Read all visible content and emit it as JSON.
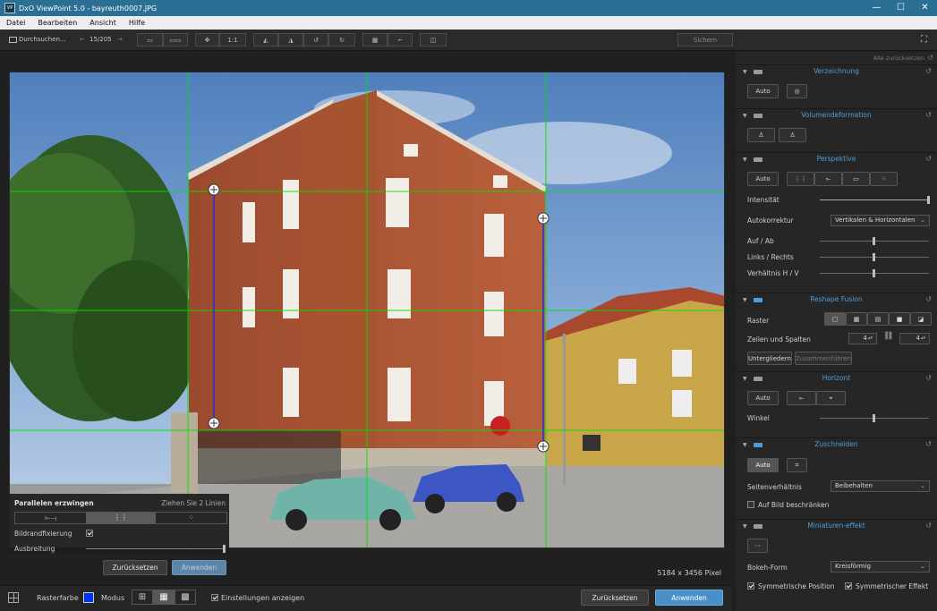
{
  "window": {
    "title": "DxO ViewPoint 5.0 - bayreuth0007.JPG",
    "app_icon": "VP",
    "min": "—",
    "max": "☐",
    "close": "✕"
  },
  "menu": [
    "Datei",
    "Bearbeiten",
    "Ansicht",
    "Hilfe"
  ],
  "toolbar": {
    "browse": "Durchsuchen...",
    "counter": "15/205",
    "prev": "←",
    "next": "→",
    "one_to_one": "1:1",
    "save": "Sichern"
  },
  "image": {
    "dimensions": "5184 x 3456 Pixel"
  },
  "parallel_panel": {
    "title": "Parallelen erzwingen",
    "hint": "Ziehen Sie 2 Linien",
    "edge_fix_label": "Bildrandfixierung",
    "edge_fix_checked": true,
    "spread_label": "Ausbreitung",
    "spread_value": 1.0,
    "reset": "Zurücksetzen",
    "apply": "Anwenden"
  },
  "bottom": {
    "grid_color_label": "Rasterfarbe",
    "grid_color": "#0033ff",
    "mode_label": "Modus",
    "show_settings_label": "Einstellungen anzeigen",
    "show_settings_checked": true,
    "reset": "Zurücksetzen",
    "apply": "Anwenden"
  },
  "right_panel": {
    "reset_all": "Alle zurücksetzen",
    "distortion": {
      "title": "Verzeichnung",
      "auto": "Auto"
    },
    "volume": {
      "title": "Volumendeformation"
    },
    "perspective": {
      "title": "Perspektive",
      "auto": "Auto",
      "intensity_label": "Intensität",
      "intensity_value": 1.0,
      "autocorrect_label": "Autokorrektur",
      "autocorrect_value": "Vertikalen & Horizontalen",
      "updown_label": "Auf / Ab",
      "updown_value": 0.5,
      "leftright_label": "Links / Rechts",
      "leftright_value": 0.5,
      "ratio_label": "Verhältnis H / V",
      "ratio_value": 0.5
    },
    "reshape": {
      "title": "Reshape Fusion",
      "grid_label": "Raster",
      "rows_cols_label": "Zeilen und Spalten",
      "rows": "4",
      "cols": "4",
      "subdivide": "Untergliedern",
      "merge": "Zusammenführen"
    },
    "horizon": {
      "title": "Horizont",
      "auto": "Auto",
      "angle_label": "Winkel",
      "angle_value": 0.5
    },
    "crop": {
      "title": "Zuschneiden",
      "auto": "Auto",
      "aspect_label": "Seitenverhältnis",
      "aspect_value": "Beibehalten",
      "limit_label": "Auf Bild beschränken",
      "limit_checked": false
    },
    "miniature": {
      "title": "Miniaturen-effekt",
      "bokeh_label": "Bokeh-Form",
      "bokeh_value": "Kreisförmig",
      "sym_pos_label": "Symmetrische Position",
      "sym_pos_checked": true,
      "sym_eff_label": "Symmetrischer Effekt",
      "sym_eff_checked": true
    }
  },
  "colors": {
    "accent": "#4f9edb",
    "titlebar": "#2c6f94",
    "guide": "#00ff00",
    "parallel_line": "#2a2ad8"
  }
}
